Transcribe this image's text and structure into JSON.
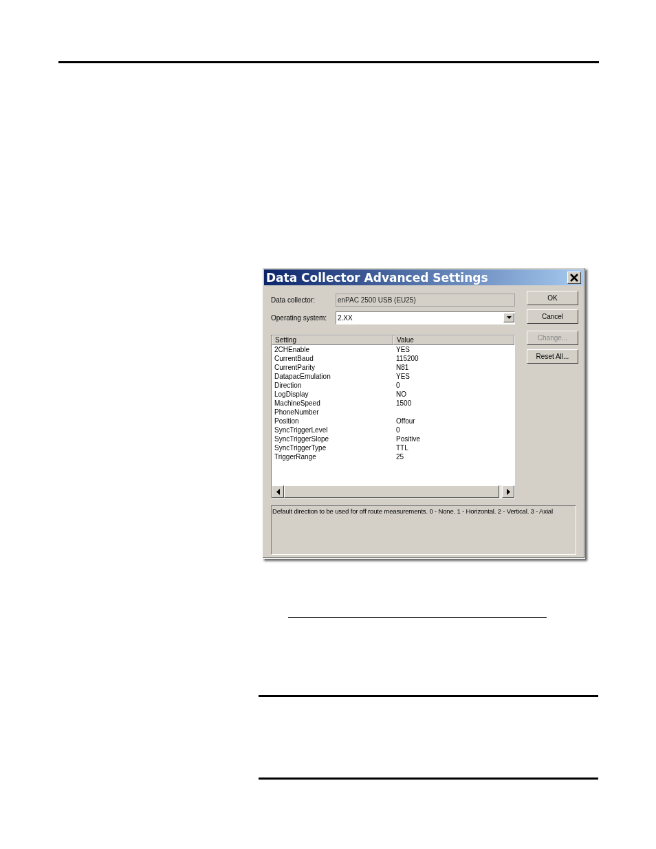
{
  "dialog": {
    "title": "Data Collector Advanced Settings",
    "fields": [
      {
        "label": "Data collector:",
        "value": "enPAC 2500 USB (EU25)",
        "kind": "readonly"
      },
      {
        "label": "Operating system:",
        "value": "2.XX",
        "kind": "dropdown"
      }
    ],
    "table": {
      "columns": [
        "Setting",
        "Value"
      ],
      "rows": [
        [
          "2CHEnable",
          "YES"
        ],
        [
          "CurrentBaud",
          "115200"
        ],
        [
          "CurrentParity",
          "N81"
        ],
        [
          "DatapacEmulation",
          "YES"
        ],
        [
          "Direction",
          "0"
        ],
        [
          "LogDisplay",
          "NO"
        ],
        [
          "MachineSpeed",
          "1500"
        ],
        [
          "PhoneNumber",
          ""
        ],
        [
          "Position",
          "Offour"
        ],
        [
          "SyncTriggerLevel",
          "0"
        ],
        [
          "SyncTriggerSlope",
          "Positive"
        ],
        [
          "SyncTriggerType",
          "TTL"
        ],
        [
          "TriggerRange",
          "25"
        ]
      ]
    },
    "buttons": [
      {
        "label": "OK",
        "disabled": false
      },
      {
        "label": "Cancel",
        "disabled": false
      },
      {
        "label": "Change...",
        "disabled": true
      },
      {
        "label": "Reset All...",
        "disabled": false
      }
    ],
    "description": "Default direction to be used for off route measurements.  0 - None. 1 - Horizontal. 2 - Vertical. 3 - Axial"
  }
}
